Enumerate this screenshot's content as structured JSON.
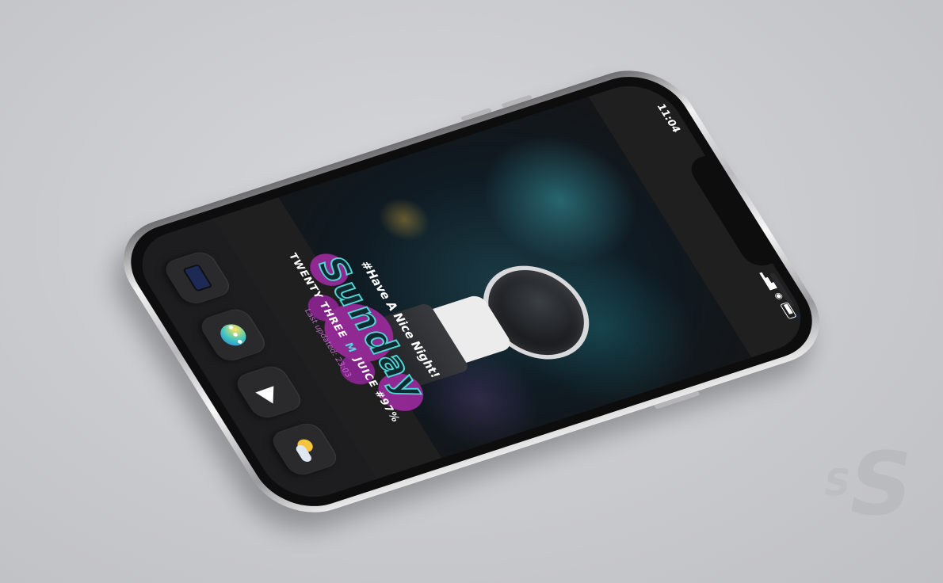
{
  "status_bar": {
    "time": "11:04"
  },
  "widget": {
    "tagline": "#Have A Nice Night!",
    "day": "Sunday",
    "info_left": "TWENTY THREE",
    "info_separator": "M",
    "info_right": "JUICE #97%",
    "last_updated": "Last updated: 23:03"
  },
  "dock": {
    "apps": [
      {
        "name": "phone-app",
        "icon": "phone-icon"
      },
      {
        "name": "messages-app",
        "icon": "messages-icon"
      },
      {
        "name": "maps-app",
        "icon": "maps-icon"
      },
      {
        "name": "weather-app",
        "icon": "weather-icon"
      }
    ]
  },
  "colors": {
    "accent_teal": "#4fd6d6",
    "splat_purple": "#9b2a9c",
    "background": "#c8c9cd"
  }
}
